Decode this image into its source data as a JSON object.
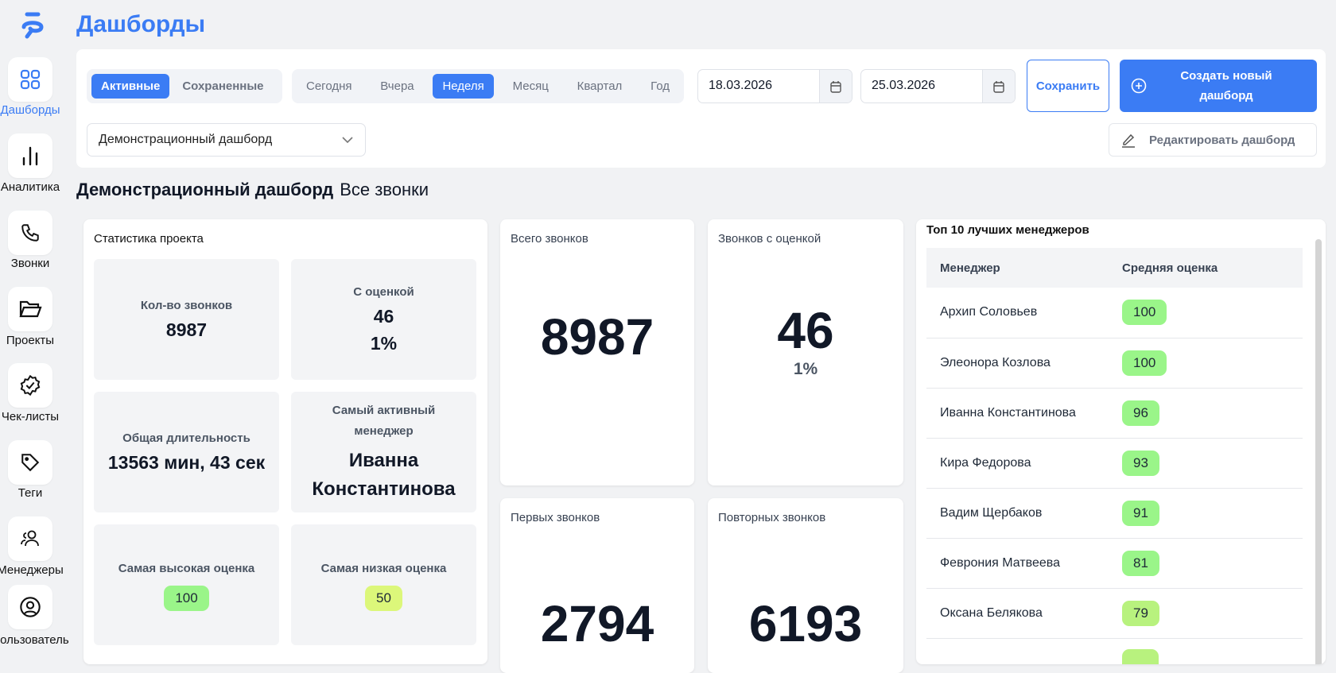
{
  "app": {
    "title": "Дашборды"
  },
  "sidebar": {
    "items": [
      {
        "label": "Дашборды",
        "icon": "grid-icon",
        "active": true
      },
      {
        "label": "Аналитика",
        "icon": "bar-chart-icon"
      },
      {
        "label": "Звонки",
        "icon": "phone-icon"
      },
      {
        "label": "Проекты",
        "icon": "folder-icon"
      },
      {
        "label": "Чек-листы",
        "icon": "badge-check-icon"
      },
      {
        "label": "Теги",
        "icon": "tag-icon"
      },
      {
        "label": "Менеджеры",
        "icon": "users-icon"
      },
      {
        "label": "Пользователь",
        "icon": "user-circle-icon"
      }
    ]
  },
  "toolbar": {
    "mode_tabs": [
      "Активные",
      "Сохраненные"
    ],
    "period_tabs": [
      "Сегодня",
      "Вчера",
      "Неделя",
      "Месяц",
      "Квартал",
      "Год"
    ],
    "active_period": "Неделя",
    "date_from": "18.03.2026",
    "date_to": "25.03.2026",
    "save_label": "Сохранить",
    "create_label": "Создать новый дашборд",
    "dashboard_select": "Демонстрационный дашборд",
    "edit_label": "Редактировать дашборд"
  },
  "heading": {
    "title": "Демонстрационный дашборд",
    "subtitle": "Все звонки"
  },
  "stats": {
    "title": "Статистика проекта",
    "calls_label": "Кол-во звонков",
    "calls_value": "8987",
    "rated_label": "С оценкой",
    "rated_value": "46",
    "rated_pct": "1%",
    "duration_label": "Общая длительность",
    "duration_value": "13563 мин, 43 сек",
    "active_label": "Самый активный менеджер",
    "active_value": "Иванна Константинова",
    "max_label": "Самая высокая оценка",
    "max_value": "100",
    "min_label": "Самая низкая оценка",
    "min_value": "50"
  },
  "kpis": {
    "total_label": "Всего звонков",
    "total": "8987",
    "rated_label": "Звонков с оценкой",
    "rated": "46",
    "rated_pct": "1%",
    "first_label": "Первых звонков",
    "first": "2794",
    "repeat_label": "Повторных звонков",
    "repeat": "6193"
  },
  "top": {
    "title": "Топ 10 лучших менеджеров",
    "col_manager": "Менеджер",
    "col_score": "Средняя оценка",
    "rows": [
      {
        "name": "Архип Соловьев",
        "score": "100"
      },
      {
        "name": "Элеонора Козлова",
        "score": "100"
      },
      {
        "name": "Иванна Константинова",
        "score": "96"
      },
      {
        "name": "Кира Федорова",
        "score": "93"
      },
      {
        "name": "Вадим Щербаков",
        "score": "91"
      },
      {
        "name": "Феврония Матвеева",
        "score": "81"
      },
      {
        "name": "Оксана Белякова",
        "score": "79"
      }
    ]
  },
  "colors": {
    "accent": "#3b7cf4",
    "badge_high": "#9af589",
    "badge_mid": "#b8f27e",
    "badge_low": "#dcf77a"
  }
}
